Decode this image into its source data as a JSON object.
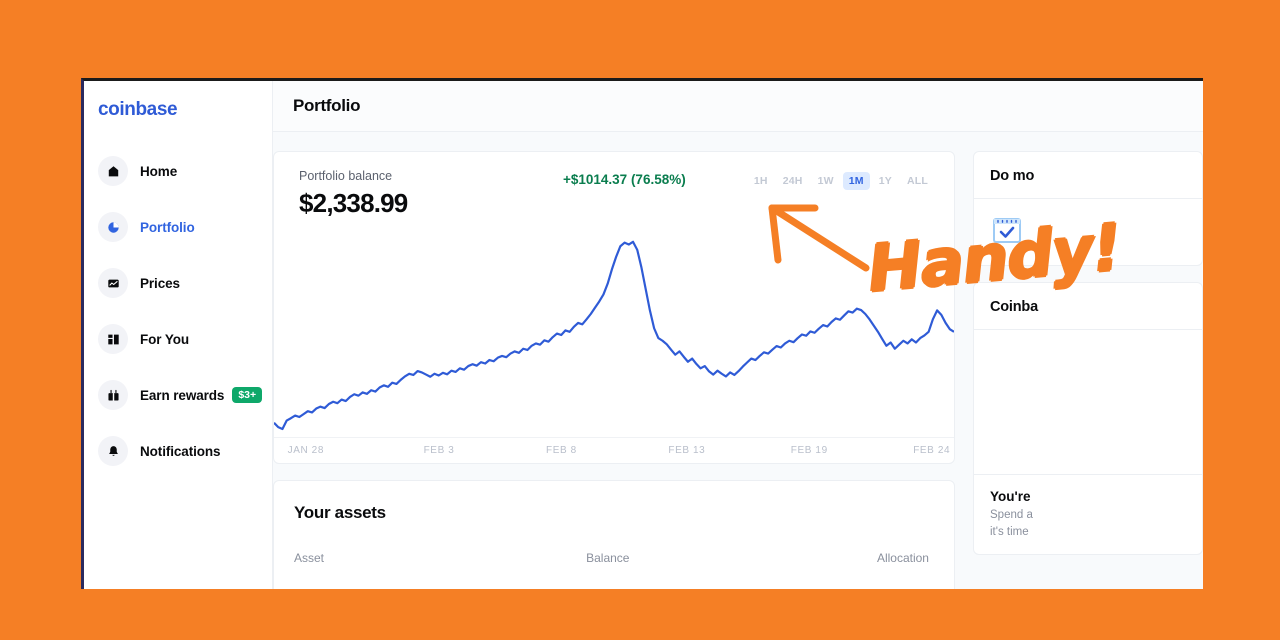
{
  "window": {
    "brand": "coinbase",
    "page_title": "Portfolio"
  },
  "sidebar": {
    "items": [
      {
        "label": "Home",
        "icon": "home-icon",
        "active": false,
        "badge": ""
      },
      {
        "label": "Portfolio",
        "icon": "pie-chart-icon",
        "active": true,
        "badge": ""
      },
      {
        "label": "Prices",
        "icon": "line-chart-icon",
        "active": false,
        "badge": ""
      },
      {
        "label": "For You",
        "icon": "layout-icon",
        "active": false,
        "badge": ""
      },
      {
        "label": "Earn rewards",
        "icon": "gift-icon",
        "active": false,
        "badge": "$3+"
      },
      {
        "label": "Notifications",
        "icon": "bell-icon",
        "active": false,
        "badge": ""
      }
    ],
    "badge_color": "#0ea86a"
  },
  "portfolio": {
    "balance_label": "Portfolio balance",
    "balance_value": "$2,338.99",
    "change_value": "+$1014.37 (76.58%)",
    "change_color": "#0a7d4e",
    "range_tabs": [
      {
        "label": "1H",
        "selected": false
      },
      {
        "label": "24H",
        "selected": false
      },
      {
        "label": "1W",
        "selected": false
      },
      {
        "label": "1M",
        "selected": true
      },
      {
        "label": "1Y",
        "selected": false
      },
      {
        "label": "ALL",
        "selected": false
      }
    ]
  },
  "chart_data": {
    "type": "line",
    "title": "Portfolio balance",
    "xlabel": "",
    "ylabel": "",
    "grid": false,
    "legend": "none",
    "line_color": "#2f5bd6",
    "tick_labels": [
      "JAN 28",
      "FEB 3",
      "FEB 8",
      "FEB 13",
      "FEB 19",
      "FEB 24"
    ],
    "tick_positions_pct": [
      2,
      22,
      40,
      58,
      76,
      94
    ],
    "x": [
      0,
      1,
      2,
      3,
      4,
      5,
      6,
      7,
      8,
      9,
      10,
      11,
      12,
      13,
      14,
      15,
      16,
      17,
      18,
      19,
      20,
      21,
      22,
      23,
      24,
      25,
      26,
      27,
      28,
      29,
      30,
      31,
      32,
      33,
      34,
      35,
      36,
      37,
      38,
      39,
      40,
      41,
      42,
      43,
      44,
      45,
      46,
      47,
      48,
      49,
      50,
      51,
      52,
      53,
      54,
      55,
      56,
      57,
      58,
      59,
      60,
      61,
      62,
      63,
      64,
      65,
      66,
      67,
      68,
      69,
      70,
      71,
      72,
      73,
      74,
      75,
      76,
      77,
      78,
      79,
      80,
      81,
      82,
      83,
      84,
      85,
      86,
      87,
      88,
      89,
      90,
      91,
      92,
      93,
      94,
      95,
      96,
      97,
      98,
      99,
      100,
      101,
      102,
      103,
      104,
      105,
      106,
      107,
      108,
      109,
      110,
      111,
      112,
      113,
      114,
      115,
      116,
      117,
      118,
      119,
      120,
      121,
      122,
      123,
      124,
      125,
      126,
      127,
      128,
      129,
      130,
      131,
      132,
      133,
      134,
      135,
      136,
      137,
      138,
      139,
      140,
      141,
      142,
      143,
      144,
      145,
      146,
      147,
      148,
      149,
      150,
      151,
      152,
      153,
      154,
      155,
      156,
      157,
      158,
      159
    ],
    "values": [
      1430,
      1405,
      1395,
      1442,
      1455,
      1470,
      1462,
      1478,
      1495,
      1488,
      1510,
      1520,
      1512,
      1535,
      1548,
      1540,
      1560,
      1552,
      1575,
      1590,
      1582,
      1600,
      1592,
      1612,
      1605,
      1628,
      1640,
      1632,
      1655,
      1648,
      1670,
      1690,
      1705,
      1698,
      1720,
      1712,
      1700,
      1688,
      1705,
      1695,
      1710,
      1702,
      1722,
      1715,
      1735,
      1728,
      1748,
      1758,
      1750,
      1770,
      1762,
      1782,
      1775,
      1795,
      1805,
      1798,
      1818,
      1830,
      1822,
      1845,
      1838,
      1862,
      1875,
      1868,
      1892,
      1885,
      1910,
      1930,
      1922,
      1948,
      1940,
      1968,
      1990,
      1982,
      2010,
      2040,
      2075,
      2110,
      2150,
      2210,
      2290,
      2360,
      2420,
      2440,
      2430,
      2445,
      2400,
      2300,
      2180,
      2060,
      1960,
      1905,
      1890,
      1870,
      1840,
      1812,
      1830,
      1800,
      1772,
      1790,
      1760,
      1735,
      1748,
      1718,
      1700,
      1722,
      1705,
      1690,
      1712,
      1698,
      1720,
      1745,
      1768,
      1790,
      1782,
      1805,
      1825,
      1818,
      1840,
      1860,
      1852,
      1875,
      1890,
      1882,
      1905,
      1925,
      1918,
      1942,
      1935,
      1958,
      1978,
      1970,
      1995,
      2015,
      2008,
      2032,
      2055,
      2048,
      2070,
      2062,
      2040,
      2010,
      1975,
      1940,
      1900,
      1862,
      1880,
      1845,
      1868,
      1890,
      1875,
      1898,
      1880,
      1905,
      1920,
      1940,
      2010,
      2060,
      2035,
      1990,
      1955,
      1940
    ],
    "ylim": [
      1350,
      2500
    ]
  },
  "assets": {
    "title": "Your assets",
    "columns": [
      "Asset",
      "Balance",
      "Allocation"
    ]
  },
  "right_rail": {
    "do_more": {
      "title": "Do mo",
      "icon": "calendar-check-icon"
    },
    "coinbase_card": {
      "title": "Coinba"
    },
    "promo": {
      "title": "You're",
      "line1": "Spend a",
      "line2": "it's time"
    }
  },
  "annotation": {
    "text": "Handy!",
    "color": "#F57F25",
    "arrow": "arrow-up-left"
  },
  "background_color": "#F57F25"
}
